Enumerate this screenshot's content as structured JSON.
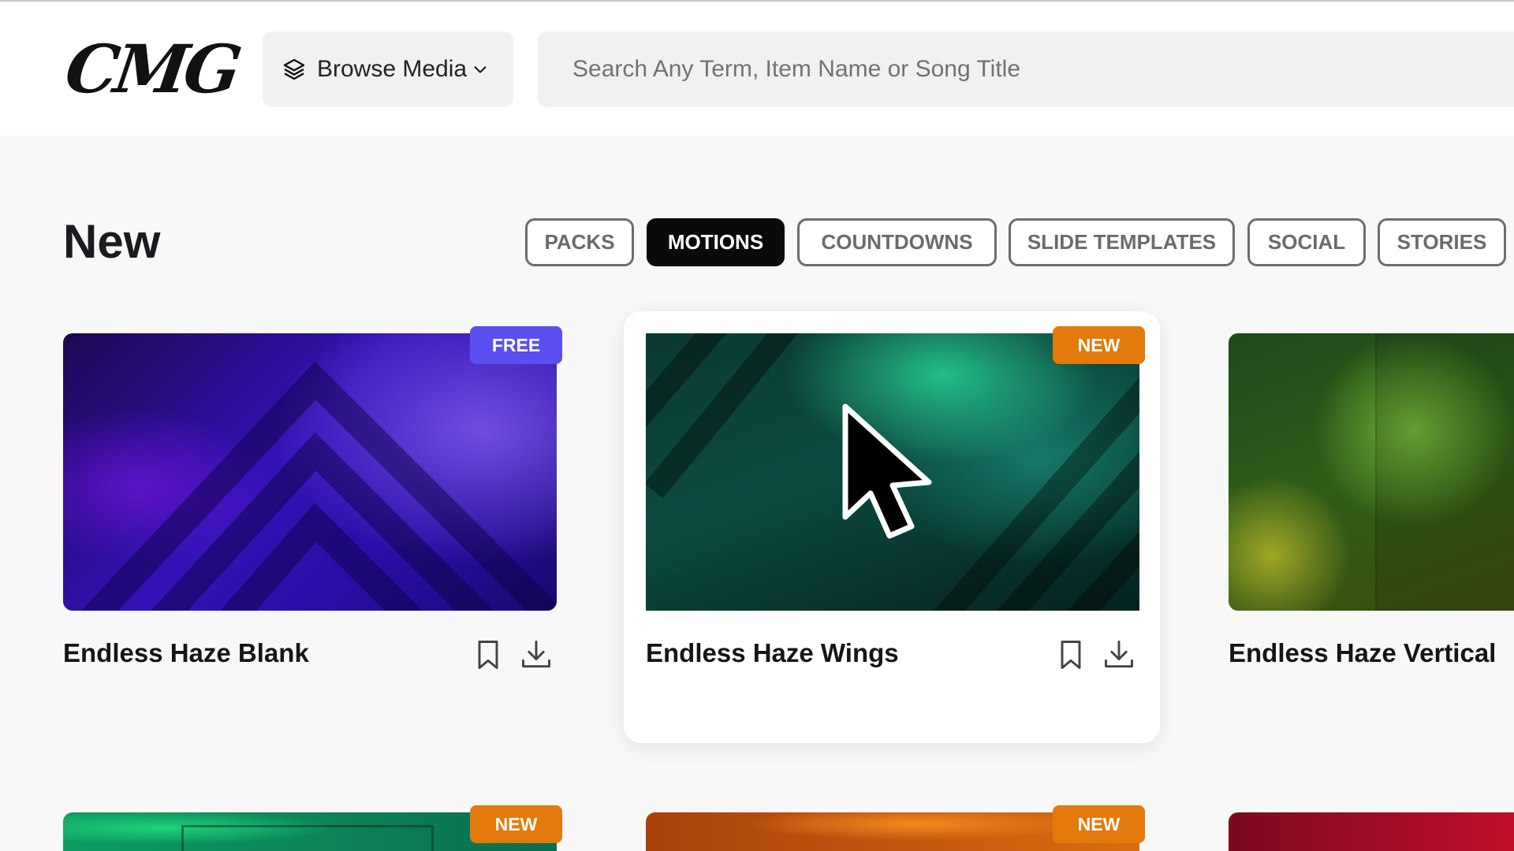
{
  "header": {
    "logo": "CMG",
    "browse_label": "Browse Media",
    "search_placeholder": "Search Any Term, Item Name or Song Title"
  },
  "section": {
    "title": "New",
    "filters": [
      "PACKS",
      "MOTIONS",
      "COUNTDOWNS",
      "SLIDE TEMPLATES",
      "SOCIAL",
      "STORIES"
    ],
    "active_filter": "MOTIONS"
  },
  "cards": [
    {
      "title": "Endless Haze Blank",
      "badge": "FREE"
    },
    {
      "title": "Endless Haze Wings",
      "badge": "NEW"
    },
    {
      "title": "Endless Haze Vertical",
      "badge": ""
    }
  ],
  "second_row": [
    {
      "badge": "NEW"
    },
    {
      "badge": "NEW"
    },
    {
      "badge": ""
    }
  ],
  "colors": {
    "free_badge": "#5b4ef0",
    "new_badge": "#e47a0b",
    "active_pill": "#0a0a0a"
  },
  "icons": [
    "layers-icon",
    "chevron-down-icon",
    "bookmark-icon",
    "download-icon",
    "cursor-icon"
  ]
}
